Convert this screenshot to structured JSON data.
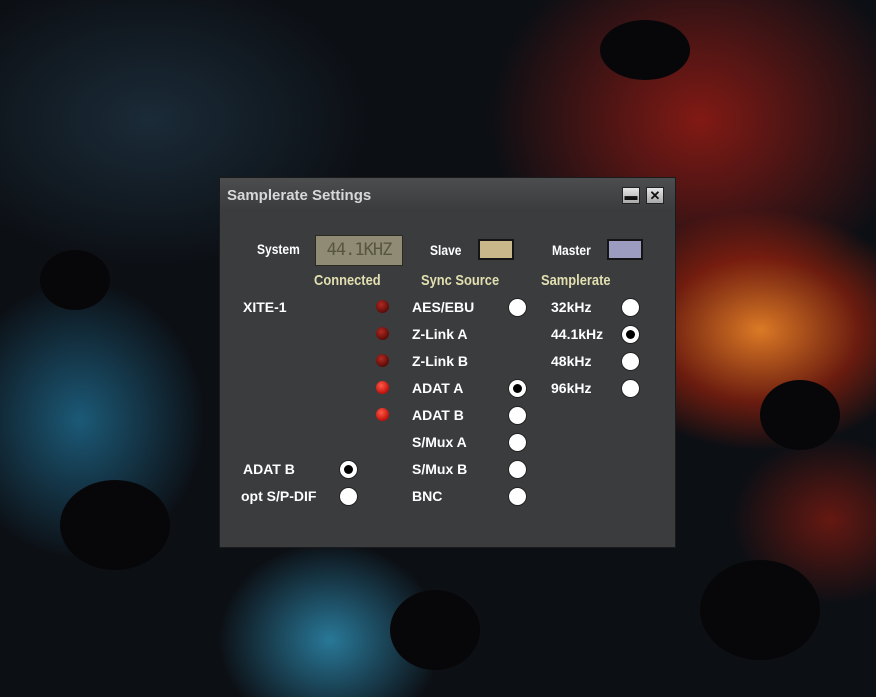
{
  "window": {
    "title": "Samplerate Settings",
    "minimize_glyph": "▬",
    "close_glyph": "✕"
  },
  "top": {
    "system_label": "System",
    "lcd_value": "44.1KHZ",
    "slave_label": "Slave",
    "slave_color": "#c8b88a",
    "master_label": "Master",
    "master_color": "#9c9cc0"
  },
  "headers": {
    "connected": "Connected",
    "sync_source": "Sync Source",
    "samplerate": "Samplerate"
  },
  "device": {
    "name": "XITE-1"
  },
  "connected_leds": [
    {
      "state": "dim"
    },
    {
      "state": "dim"
    },
    {
      "state": "dim"
    },
    {
      "state": "on"
    },
    {
      "state": "on"
    }
  ],
  "sync_sources": [
    {
      "label": "AES/EBU",
      "selected": false
    },
    {
      "label": "Z-Link A",
      "selected": false
    },
    {
      "label": "Z-Link B",
      "selected": false
    },
    {
      "label": "ADAT A",
      "selected": true
    },
    {
      "label": "ADAT B",
      "selected": false
    },
    {
      "label": "S/Mux A",
      "selected": false
    },
    {
      "label": "S/Mux B",
      "selected": false
    },
    {
      "label": "BNC",
      "selected": false
    }
  ],
  "samplerates": [
    {
      "label": "32kHz",
      "selected": false
    },
    {
      "label": "44.1kHz",
      "selected": true
    },
    {
      "label": "48kHz",
      "selected": false
    },
    {
      "label": "96kHz",
      "selected": false
    }
  ],
  "output_options": [
    {
      "label": "ADAT B",
      "selected": true
    },
    {
      "label": "opt S/P-DIF",
      "selected": false
    }
  ]
}
